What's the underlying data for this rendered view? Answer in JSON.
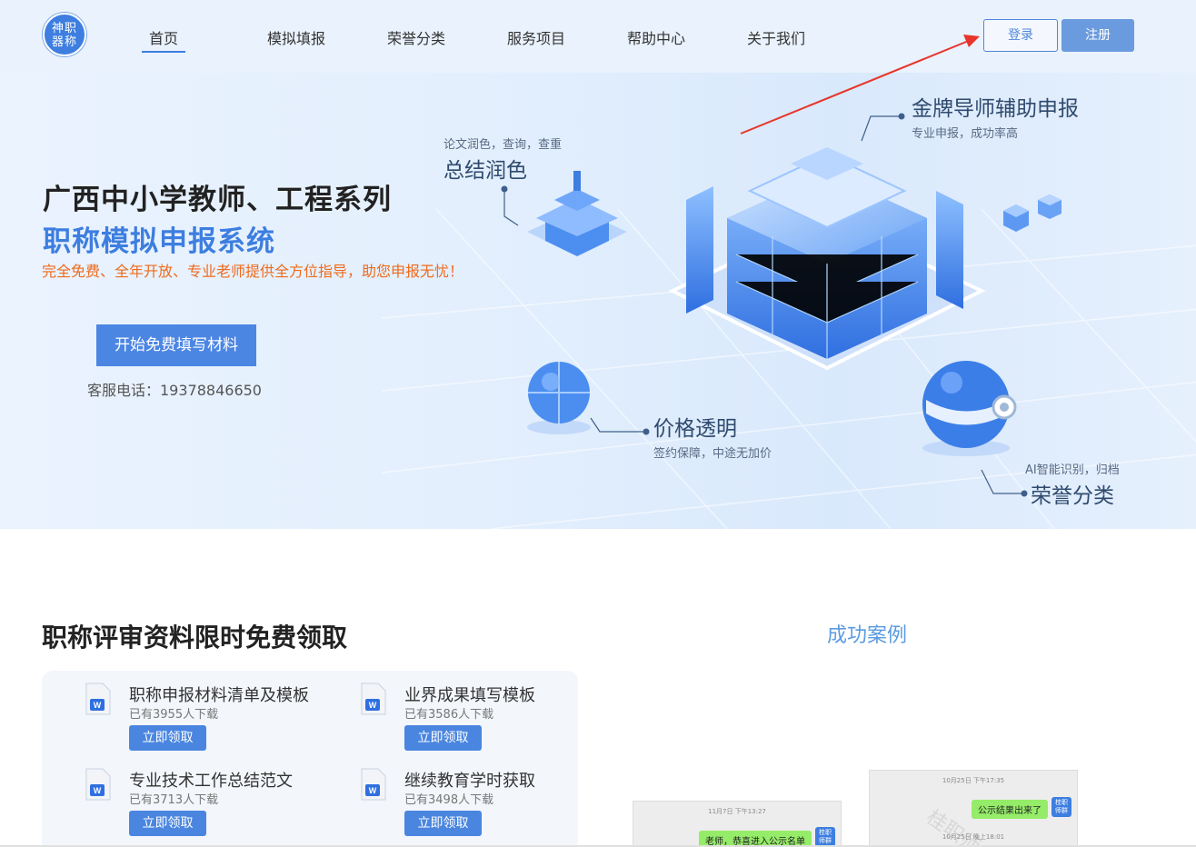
{
  "header": {
    "logo_line1": "神职",
    "logo_line2": "器称",
    "nav": [
      "首页",
      "模拟填报",
      "荣誉分类",
      "服务项目",
      "帮助中心",
      "关于我们"
    ],
    "active_nav": "首页",
    "login_label": "登录",
    "register_label": "注册"
  },
  "hero": {
    "title_line1": "广西中小学教师、工程系列",
    "title_line2": "职称模拟申报系统",
    "subtitle": "完全免费、全年开放、专业老师提供全方位指导，助您申报无忧！",
    "cta_label": "开始免费填写材料",
    "phone": "客服电话：19378846650",
    "features": {
      "f1_small": "专业申报，成功率高",
      "f1_big": "金牌导师辅助申报",
      "f2_small": "论文润色，查询，查重",
      "f2_big": "总结润色",
      "f3_small": "签约保障，中途无加价",
      "f3_big": "价格透明",
      "f4_small": "AI智能识别，归档",
      "f4_big": "荣誉分类"
    }
  },
  "resources": {
    "title": "职称评审资料限时免费领取",
    "items": [
      {
        "name": "职称申报材料清单及模板",
        "count": "已有3955人下载",
        "button": "立即领取"
      },
      {
        "name": "业界成果填写模板",
        "count": "已有3586人下载",
        "button": "立即领取"
      },
      {
        "name": "专业技术工作总结范文",
        "count": "已有3713人下载",
        "button": "立即领取"
      },
      {
        "name": "继续教育学时获取",
        "count": "已有3498人下载",
        "button": "立即领取"
      }
    ],
    "doc_badge": "W"
  },
  "cases": {
    "title": "成功案例",
    "card1": {
      "time": "11月7日 下午13:27",
      "message": "老师，恭喜进入公示名单",
      "avatar": "桂职 师群"
    },
    "card2": {
      "time": "10月25日 下午17:35",
      "message": "公示结果出来了",
      "avatar": "桂职 师群",
      "time2": "10月25日 晚上18:01",
      "watermark": "桂职师"
    }
  },
  "colors": {
    "accent": "#3d7ee0",
    "orange": "#f06a1c",
    "arrow": "#e8352b"
  }
}
